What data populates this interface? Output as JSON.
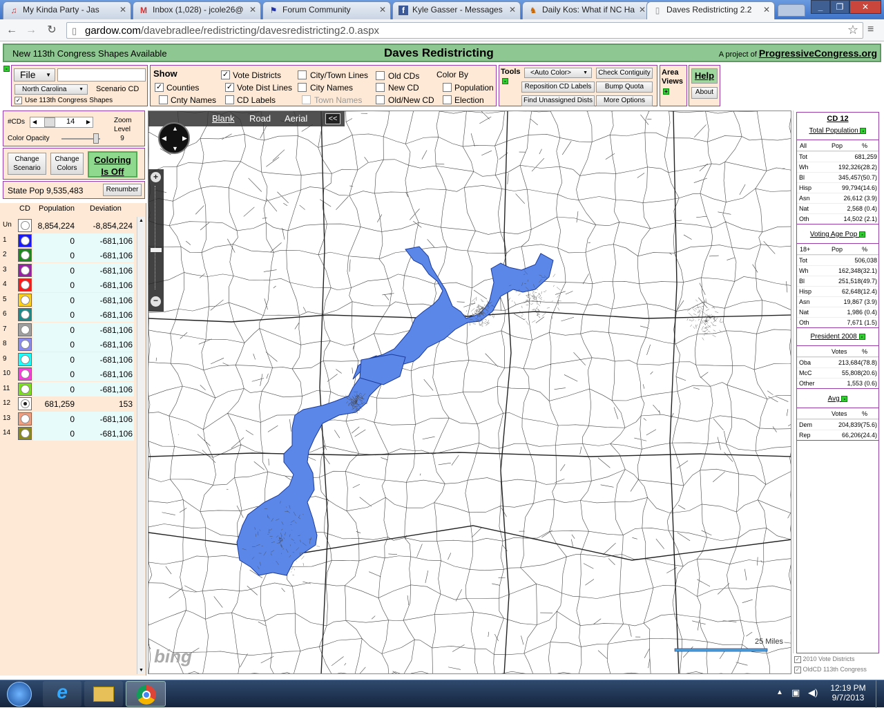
{
  "browser": {
    "tabs": [
      {
        "label": "My Kinda Party - Jas",
        "icon": "music-icon"
      },
      {
        "label": "Inbox (1,028) - jcole26@",
        "icon": "gmail-icon"
      },
      {
        "label": "Forum Community",
        "icon": "flag-icon"
      },
      {
        "label": "Kyle Gasser - Messages",
        "icon": "facebook-icon"
      },
      {
        "label": "Daily Kos: What if NC Ha",
        "icon": "dailykos-icon"
      },
      {
        "label": "Daves Redistricting 2.2",
        "icon": "page-icon"
      }
    ],
    "url_domain": "gardow.com",
    "url_path": "/davebradlee/redistricting/davesredistricting2.0.aspx"
  },
  "banner": {
    "left": "New 113th Congress Shapes Available",
    "center": "Daves Redistricting",
    "right_prefix": "A project of",
    "right_link": "ProgressiveCongress.org"
  },
  "file_panel": {
    "file_label": "File",
    "state": "North Carolina",
    "scenario": "Scenario CD",
    "use113": "Use 113th Congress Shapes"
  },
  "show_panel": {
    "title": "Show",
    "items": [
      "Vote Districts",
      "Vote Dist Lines",
      "CD Labels",
      "Counties",
      "Cnty Names",
      "City/Town Lines",
      "City Names",
      "Town Names",
      "Old CDs",
      "New CD",
      "Old/New CD"
    ],
    "color_by": "Color By",
    "color_opts": [
      "Population",
      "Election"
    ]
  },
  "tools": {
    "title": "Tools",
    "auto_color": "<Auto Color>",
    "reposition": "Reposition CD Labels",
    "find_unassigned": "Find Unassigned Dists",
    "check_contiguity": "Check Contiguity",
    "bump_quota": "Bump Quota",
    "more_options": "More Options"
  },
  "area": {
    "title1": "Area",
    "title2": "Views",
    "help": "Help",
    "about": "About"
  },
  "controls": {
    "cds_label": "#CDs",
    "cds_value": "14",
    "zoom_label": "Zoom",
    "zoom_level_label": "Level",
    "zoom_value": "9",
    "opacity_label": "Color Opacity",
    "change_scenario_1": "Change",
    "change_scenario_2": "Scenario",
    "change_colors_1": "Change",
    "change_colors_2": "Colors",
    "coloring_1": "Coloring",
    "coloring_2": "Is Off",
    "state_pop_label": "State Pop",
    "state_pop_value": "9,535,483",
    "renumber": "Renumber"
  },
  "district_table": {
    "headers": [
      "CD",
      "Population",
      "Deviation"
    ],
    "rows": [
      {
        "cd": "Un",
        "pop": "8,854,224",
        "dev": "-8,854,224",
        "color": "#ffffff"
      },
      {
        "cd": "1",
        "pop": "0",
        "dev": "-681,106",
        "color": "#1a1aff"
      },
      {
        "cd": "2",
        "pop": "0",
        "dev": "-681,106",
        "color": "#1a8a1a"
      },
      {
        "cd": "3",
        "pop": "0",
        "dev": "-681,106",
        "color": "#9b1fa8"
      },
      {
        "cd": "4",
        "pop": "0",
        "dev": "-681,106",
        "color": "#ff1a1a"
      },
      {
        "cd": "5",
        "pop": "0",
        "dev": "-681,106",
        "color": "#ffd21a"
      },
      {
        "cd": "6",
        "pop": "0",
        "dev": "-681,106",
        "color": "#1a8a8a"
      },
      {
        "cd": "7",
        "pop": "0",
        "dev": "-681,106",
        "color": "#a0a0a0"
      },
      {
        "cd": "8",
        "pop": "0",
        "dev": "-681,106",
        "color": "#8a8af0"
      },
      {
        "cd": "9",
        "pop": "0",
        "dev": "-681,106",
        "color": "#1affff"
      },
      {
        "cd": "10",
        "pop": "0",
        "dev": "-681,106",
        "color": "#ff3ae0"
      },
      {
        "cd": "11",
        "pop": "0",
        "dev": "-681,106",
        "color": "#7ae01a"
      },
      {
        "cd": "12",
        "pop": "681,259",
        "dev": "153",
        "color": "#ffffff"
      },
      {
        "cd": "13",
        "pop": "0",
        "dev": "-681,106",
        "color": "#f0a080"
      },
      {
        "cd": "14",
        "pop": "0",
        "dev": "-681,106",
        "color": "#8a8a1a"
      }
    ]
  },
  "map": {
    "views": [
      "Blank",
      "Road",
      "Aerial"
    ],
    "collapse": "<<",
    "scale": "25 Miles",
    "logo": "bing",
    "district_color": "#5b87e8"
  },
  "right": {
    "title": "CD 12",
    "total_pop_title": "Total Population",
    "total_hd": [
      "All",
      "Pop",
      "%"
    ],
    "total": [
      [
        "Tot",
        "681,259"
      ],
      [
        "Wh",
        "192,326(28.2)"
      ],
      [
        "Bl",
        "345,457(50.7)"
      ],
      [
        "Hisp",
        "99,794(14.6)"
      ],
      [
        "Asn",
        "26,612 (3.9)"
      ],
      [
        "Nat",
        "2,568 (0.4)"
      ],
      [
        "Oth",
        "14,502 (2.1)"
      ]
    ],
    "vap_title": "Voting Age Pop",
    "vap_hd": [
      "18+",
      "Pop",
      "%"
    ],
    "vap": [
      [
        "Tot",
        "506,038"
      ],
      [
        "Wh",
        "162,348(32.1)"
      ],
      [
        "Bl",
        "251,518(49.7)"
      ],
      [
        "Hisp",
        "62,648(12.4)"
      ],
      [
        "Asn",
        "19,867 (3.9)"
      ],
      [
        "Nat",
        "1,986 (0.4)"
      ],
      [
        "Oth",
        "7,671 (1.5)"
      ]
    ],
    "pres_title": "President 2008",
    "pres_hd": [
      "",
      "Votes",
      "%"
    ],
    "pres": [
      [
        "Oba",
        "213,684(78.8)"
      ],
      [
        "McC",
        "55,808(20.6)"
      ],
      [
        "Other",
        "1,553 (0.6)"
      ]
    ],
    "avg_title": "Avg",
    "avg_hd": [
      "",
      "Votes",
      "%"
    ],
    "avg": [
      [
        "Dem",
        "204,839(75.6)"
      ],
      [
        "Rep",
        "66,206(24.4)"
      ]
    ],
    "legend": [
      "2010 Vote Districts",
      "OldCD 113th Congress"
    ]
  },
  "taskbar": {
    "time": "12:19 PM",
    "date": "9/7/2013"
  }
}
